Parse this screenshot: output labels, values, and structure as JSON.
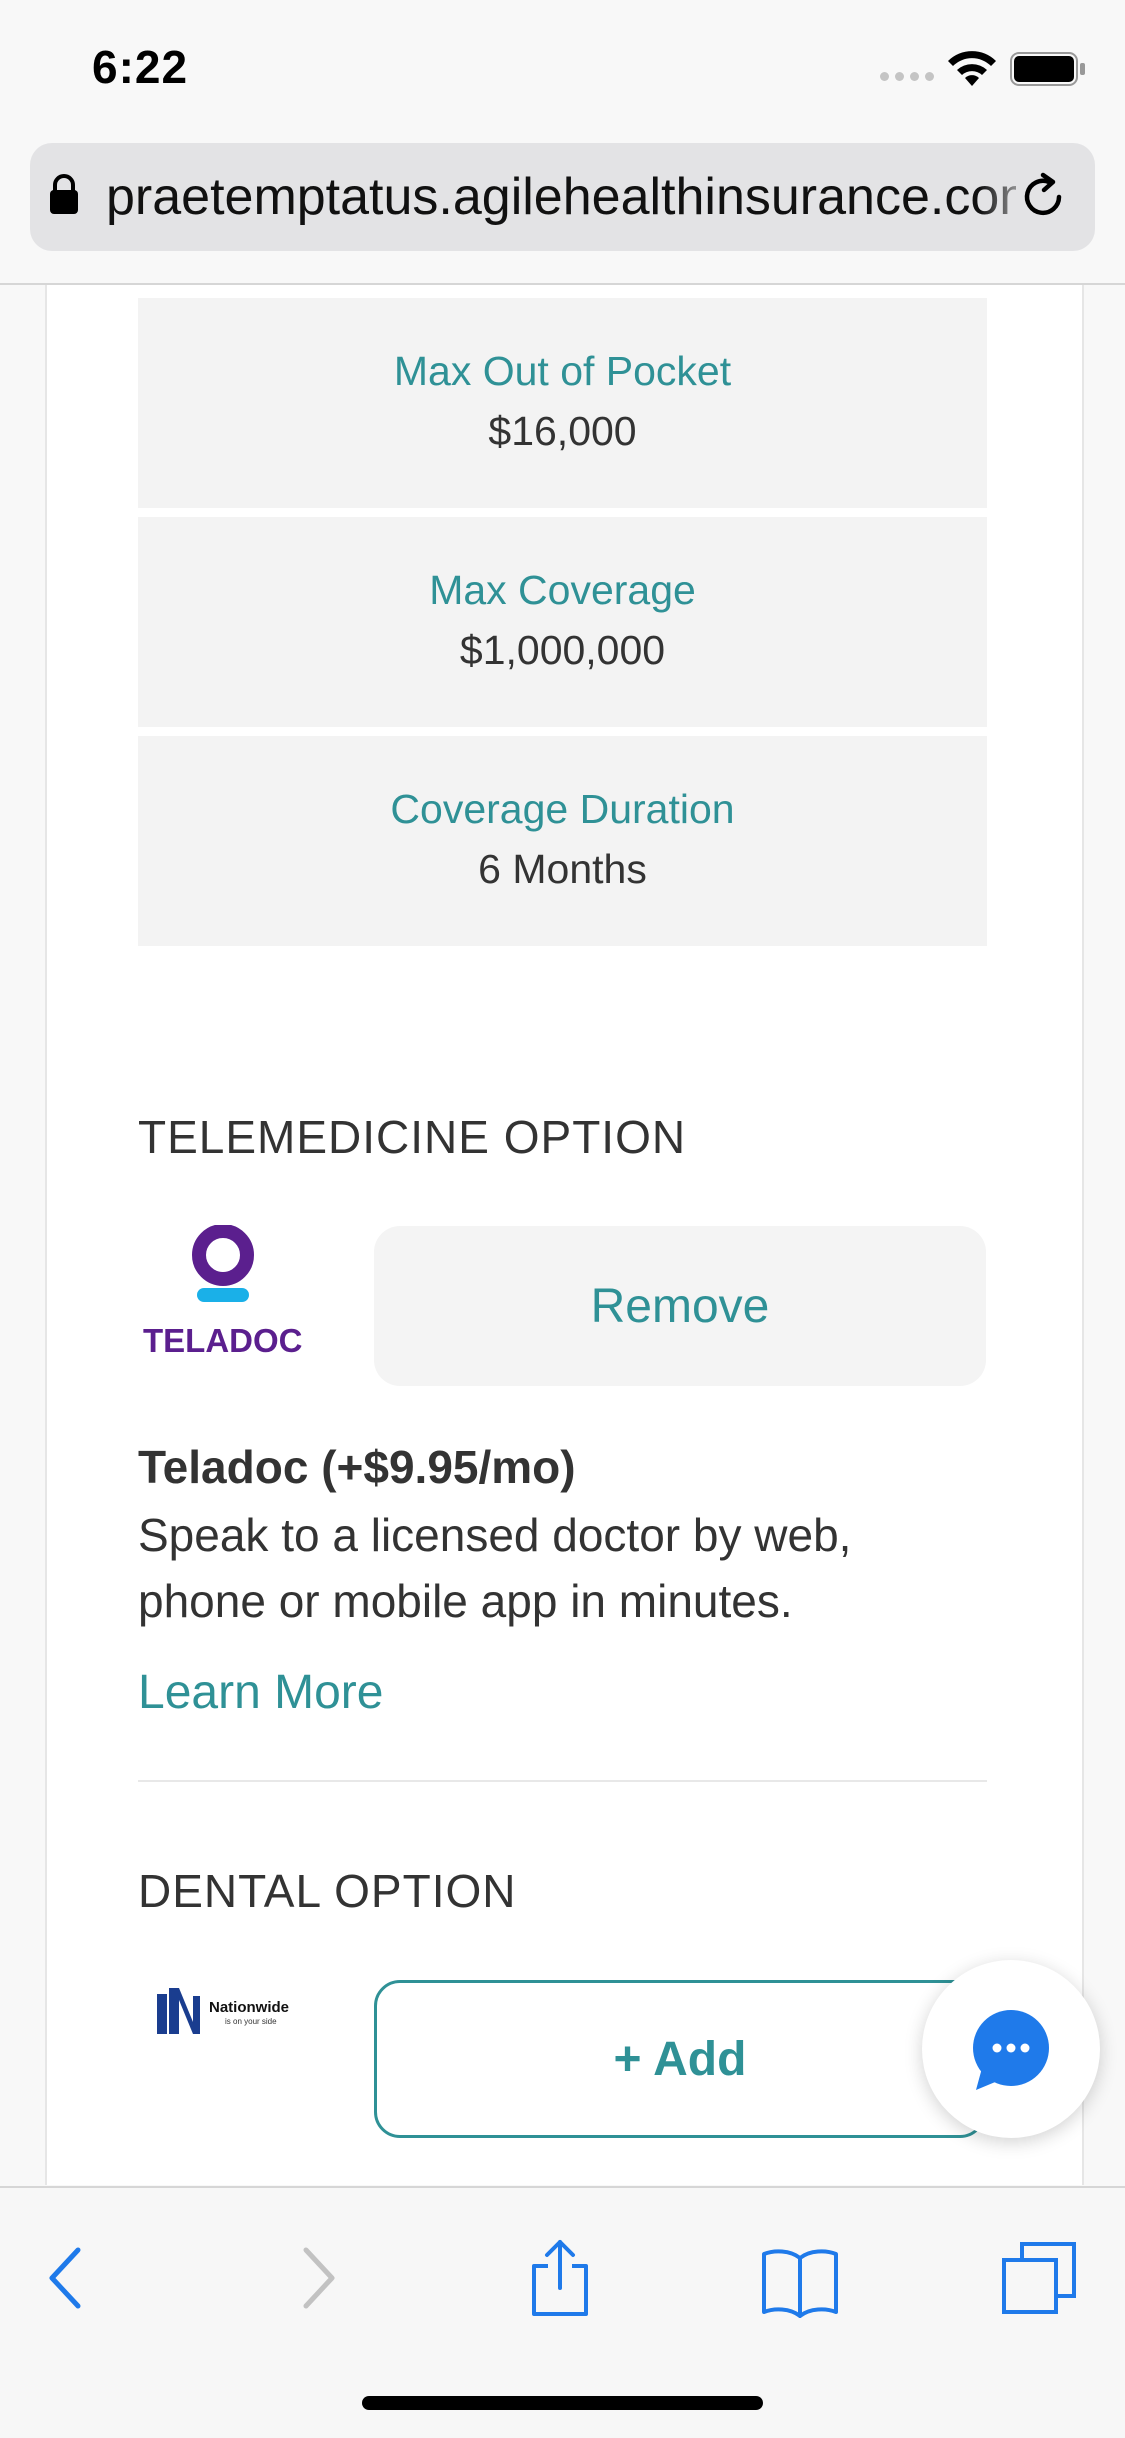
{
  "status_bar": {
    "time": "6:22"
  },
  "browser": {
    "url": "praetemptatus.agilehealthinsurance.com"
  },
  "plan_details": [
    {
      "label": "Max Out of Pocket",
      "value": "$16,000"
    },
    {
      "label": "Max Coverage",
      "value": "$1,000,000"
    },
    {
      "label": "Coverage Duration",
      "value": "6 Months"
    }
  ],
  "telemedicine": {
    "heading": "TELEMEDICINE OPTION",
    "logo_text": "TELADOC",
    "button_label": "Remove",
    "title": "Teladoc (+$9.95/mo)",
    "description": "Speak to a licensed doctor by web, phone or mobile app in minutes.",
    "learn_more": "Learn More"
  },
  "dental": {
    "heading": "DENTAL OPTION",
    "logo_text": "Nationwide",
    "logo_tagline": "is on your side",
    "button_label": "+ Add"
  },
  "colors": {
    "accent": "#2f9196",
    "teladoc_purple": "#5b1f8e",
    "teladoc_blue": "#1ab0e8",
    "ios_blue": "#1f7aea"
  },
  "icons": {
    "lock": "lock-icon",
    "reload": "reload-icon",
    "chat": "chat-bubble-icon",
    "back": "chevron-left-icon",
    "forward": "chevron-right-icon",
    "share": "share-icon",
    "bookmarks": "book-icon",
    "tabs": "tabs-icon"
  }
}
